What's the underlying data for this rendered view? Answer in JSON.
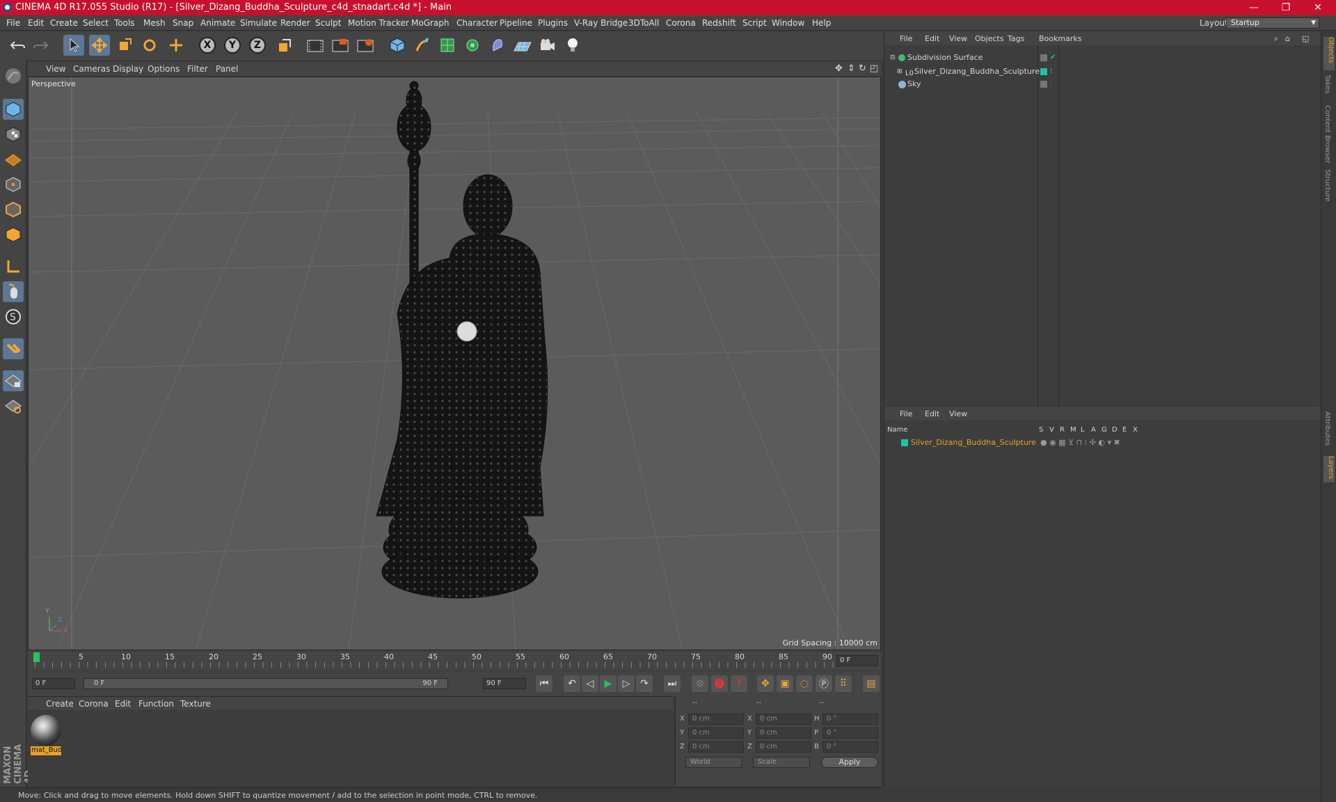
{
  "window": {
    "title": "CINEMA 4D R17.055 Studio (R17) - [Silver_Dizang_Buddha_Sculpture_c4d_stnadart.c4d *] - Main",
    "controls": [
      "—",
      "❐",
      "✕"
    ]
  },
  "menubar": {
    "items": [
      "File",
      "Edit",
      "Create",
      "Select",
      "Tools",
      "Mesh",
      "Snap",
      "Animate",
      "Simulate",
      "Render",
      "Sculpt",
      "Motion Tracker",
      "MoGraph",
      "Character",
      "Pipeline",
      "Plugins",
      "V-Ray Bridge",
      "3DToAll",
      "Corona",
      "Redshift",
      "Script",
      "Window",
      "Help"
    ],
    "layout_label": "Layout:",
    "layout_value": "Startup"
  },
  "toolbar": {
    "icons": [
      "undo-icon",
      "redo-icon",
      "select-arrow-icon",
      "move-icon",
      "scale-icon",
      "rotate-icon",
      "live-move-icon",
      "x-axis-icon",
      "y-axis-icon",
      "z-axis-icon",
      "coordinate-system-icon",
      "render-view-icon",
      "render-picture-viewer-icon",
      "render-settings-icon",
      "cube-primitive-icon",
      "pen-spline-icon",
      "subdivision-icon",
      "array-icon",
      "deformer-icon",
      "floor-icon",
      "camera-icon",
      "light-icon"
    ],
    "axis_labels": [
      "X",
      "Y",
      "Z"
    ]
  },
  "left_toolbar": {
    "icons": [
      "sculpt-brush-icon",
      "model-mode-icon",
      "texture-mode-icon",
      "workplane-icon",
      "points-mode-icon",
      "edges-mode-icon",
      "polygons-mode-icon",
      "axis-mode-icon",
      "tweak-mode-icon",
      "solo-icon",
      "snap-magnet-icon",
      "workplane-lock-icon",
      "grid-snap-icon"
    ]
  },
  "viewport": {
    "menu": [
      "View",
      "Cameras",
      "Display",
      "Options",
      "Filter",
      "Panel"
    ],
    "label": "Perspective",
    "grid_spacing": "Grid Spacing : 10000 cm",
    "axis": {
      "x": "X",
      "y": "Y",
      "z": "Z"
    }
  },
  "timeline": {
    "ticks": [
      "0",
      "5",
      "10",
      "15",
      "20",
      "25",
      "30",
      "35",
      "40",
      "45",
      "50",
      "55",
      "60",
      "65",
      "70",
      "75",
      "80",
      "85",
      "90"
    ],
    "current_frame": "0 F",
    "start_field": "0 F",
    "range_start": "0 F",
    "range_end": "90 F",
    "end_field": "90 F"
  },
  "material_manager": {
    "menu": [
      "Create",
      "Corona",
      "Edit",
      "Function",
      "Texture"
    ],
    "material_name": "mat_Bud"
  },
  "coordinates": {
    "headers": [
      "--",
      "--",
      "--"
    ],
    "rows": [
      {
        "l1": "X",
        "v1": "0 cm",
        "l2": "X",
        "v2": "0 cm",
        "l3": "H",
        "v3": "0 °"
      },
      {
        "l1": "Y",
        "v1": "0 cm",
        "l2": "Y",
        "v2": "0 cm",
        "l3": "P",
        "v3": "0 °"
      },
      {
        "l1": "Z",
        "v1": "0 cm",
        "l2": "Z",
        "v2": "0 cm",
        "l3": "B",
        "v3": "0 °"
      }
    ],
    "mode_select": "World",
    "scale_select": "Scale",
    "apply_label": "Apply"
  },
  "status": {
    "text": "Move: Click and drag to move elements. Hold down SHIFT to quantize movement / add to the selection in point mode, CTRL to remove."
  },
  "object_manager": {
    "menu": [
      "File",
      "Edit",
      "View",
      "Objects",
      "Tags",
      "Bookmarks"
    ],
    "objects": [
      {
        "name": "Subdivision Surface",
        "indent": 0
      },
      {
        "name": "Silver_Dizang_Buddha_Sculpture",
        "indent": 1
      },
      {
        "name": "Sky",
        "indent": 0
      }
    ]
  },
  "layer_manager": {
    "menu": [
      "File",
      "Edit",
      "View"
    ],
    "columns": [
      "Name",
      "S",
      "V",
      "R",
      "M",
      "L",
      "A",
      "G",
      "D",
      "E",
      "X"
    ],
    "layers": [
      {
        "name": "Silver_Dizang_Buddha_Sculpture",
        "color": "#19c6a0"
      }
    ]
  },
  "side_tabs": [
    "Objects",
    "Takes",
    "Content Browser",
    "Structure",
    "Attributes",
    "Layers"
  ],
  "colors": {
    "accent": "#e8a12a",
    "title_bar": "#c8102e",
    "selection": "#5c7896",
    "layer_color": "#19c6a0"
  }
}
